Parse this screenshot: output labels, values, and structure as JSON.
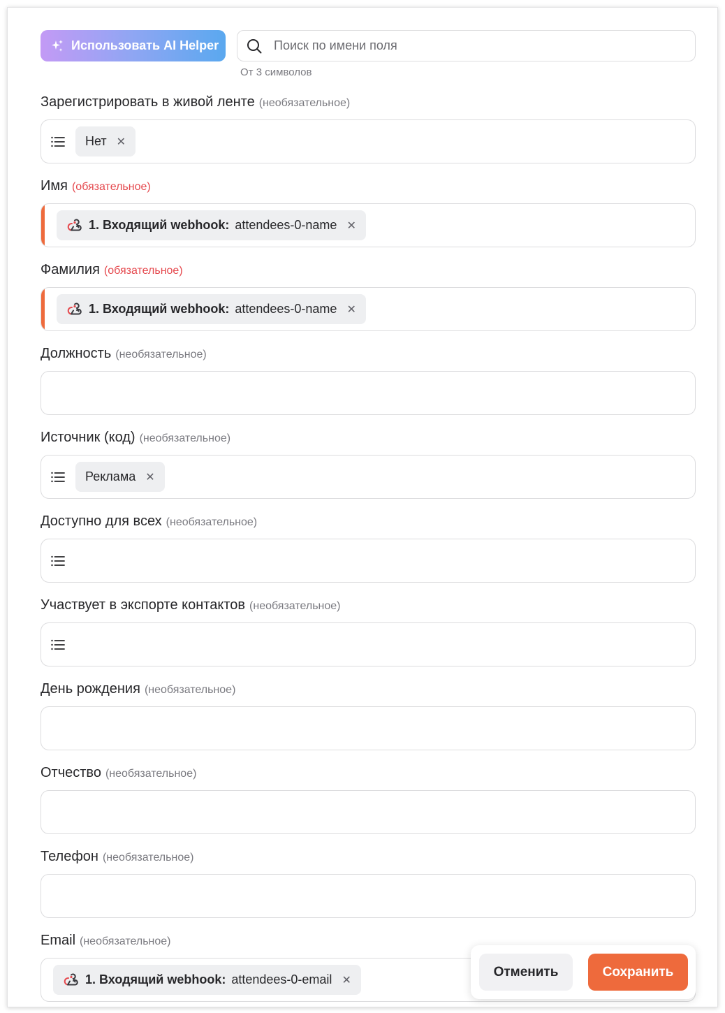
{
  "toolbar": {
    "ai_helper_label": "Использовать AI Helper",
    "search_placeholder": "Поиск по имени поля",
    "search_hint": "От 3 символов"
  },
  "markers": {
    "optional": "(необязательное)",
    "required": "(обязательное)"
  },
  "fields": [
    {
      "label": "Зарегистрировать в живой ленте",
      "kind": "optional",
      "type": "select",
      "value": "Нет"
    },
    {
      "label": "Имя",
      "kind": "required",
      "type": "mapping",
      "source": "1. Входящий webhook:",
      "value": "attendees-0-name"
    },
    {
      "label": "Фамилия",
      "kind": "required",
      "type": "mapping",
      "source": "1. Входящий webhook:",
      "value": "attendees-0-name"
    },
    {
      "label": "Должность",
      "kind": "optional",
      "type": "text",
      "value": ""
    },
    {
      "label": "Источник (код)",
      "kind": "optional",
      "type": "select",
      "value": "Реклама"
    },
    {
      "label": "Доступно для всех",
      "kind": "optional",
      "type": "select",
      "value": ""
    },
    {
      "label": "Участвует в экспорте контактов",
      "kind": "optional",
      "type": "select",
      "value": ""
    },
    {
      "label": "День рождения",
      "kind": "optional",
      "type": "text",
      "value": ""
    },
    {
      "label": "Отчество",
      "kind": "optional",
      "type": "text",
      "value": ""
    },
    {
      "label": "Телефон",
      "kind": "optional",
      "type": "text",
      "value": ""
    },
    {
      "label": "Email",
      "kind": "optional",
      "type": "mapping",
      "source": "1. Входящий webhook:",
      "value": "attendees-0-email"
    }
  ],
  "footer": {
    "cancel_label": "Отменить",
    "save_label": "Сохранить"
  },
  "colors": {
    "accent": "#ee6a3c",
    "required_text": "#e5484d",
    "ai_gradient_start": "#c39af5",
    "ai_gradient_end": "#5aa8ef",
    "chip_bg": "#eeeff1"
  },
  "icons": {
    "ai_helper": "sparkles-icon",
    "search": "search-icon",
    "select": "list-icon",
    "mapping": "webhook-icon",
    "remove": "close-icon"
  }
}
